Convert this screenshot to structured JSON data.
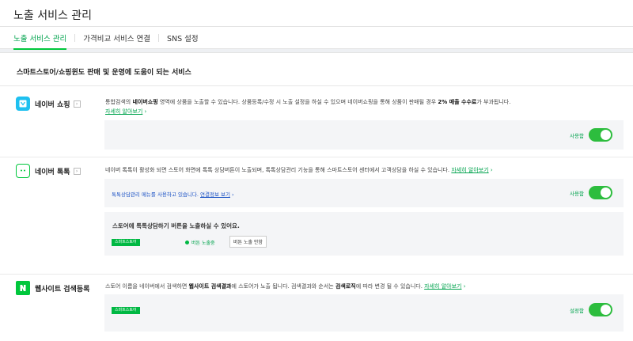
{
  "header": {
    "title": "노출 서비스 관리"
  },
  "tabs": [
    {
      "label": "노출 서비스 관리",
      "active": true
    },
    {
      "label": "가격비교 서비스 연결",
      "active": false
    },
    {
      "label": "SNS 설정",
      "active": false
    }
  ],
  "section": {
    "title": "스마트스토어/쇼핑윈도 판매 및 운영에 도움이 되는 서비스"
  },
  "shopping": {
    "name": "네이버 쇼핑",
    "desc_a": "통합검색의 ",
    "desc_b": "네이버쇼핑",
    "desc_c": " 영역에 상품을 노출할 수 있습니다. 상품등록/수정 시 노출 설정을 하실 수 있으며 네이버쇼핑을 통해 상품이 판매될 경우 ",
    "desc_d": "2% 매출 수수료",
    "desc_e": "가 부과됩니다.",
    "more": "자세히 알아보기",
    "toggle_label": "사용함"
  },
  "talktalk": {
    "name": "네이버 톡톡",
    "desc": "네이버 톡톡이 활성화 되면 스토어 화면에 톡톡 상담버튼이 노출되며, 톡톡상담관리 기능을 통해 스마트스토어 센터에서 고객상담을 하실 수 있습니다.",
    "more": "자세히 알아보기",
    "notice_a": "톡톡상담관리 메뉴를 사용하고 있습니다. ",
    "notice_link": "연결정보 보기",
    "toggle_label": "사용함",
    "question": "스토어에 톡톡상담하기 버튼을 노출하실 수 있어요.",
    "tag": "스마트스토어",
    "radio_on": "버튼 노출중",
    "btn_off": "버튼 노출 안함"
  },
  "website": {
    "name": "웹사이트 검색등록",
    "desc_a": "스토어 이름을 네이버에서 검색하면 ",
    "desc_b": "웹사이트 검색결과",
    "desc_c": "에 스토어가 노출 됩니다. 검색결과와 순서는 ",
    "desc_d": "검색로직",
    "desc_e": "에 따라 변경 될 수 있습니다.",
    "more": "자세히 알아보기",
    "tag": "스마트스토어",
    "toggle_label": "설정함"
  },
  "icons": {
    "shopping": "shopping-bag-icon",
    "talktalk": "chat-bubble-icon",
    "website": "naver-n-icon",
    "chevron": "chevron-right-icon"
  },
  "colors": {
    "accent": "#00c73c",
    "link": "#00a34d",
    "notice": "#1b52c5",
    "toggle": "#2dbd3e"
  }
}
